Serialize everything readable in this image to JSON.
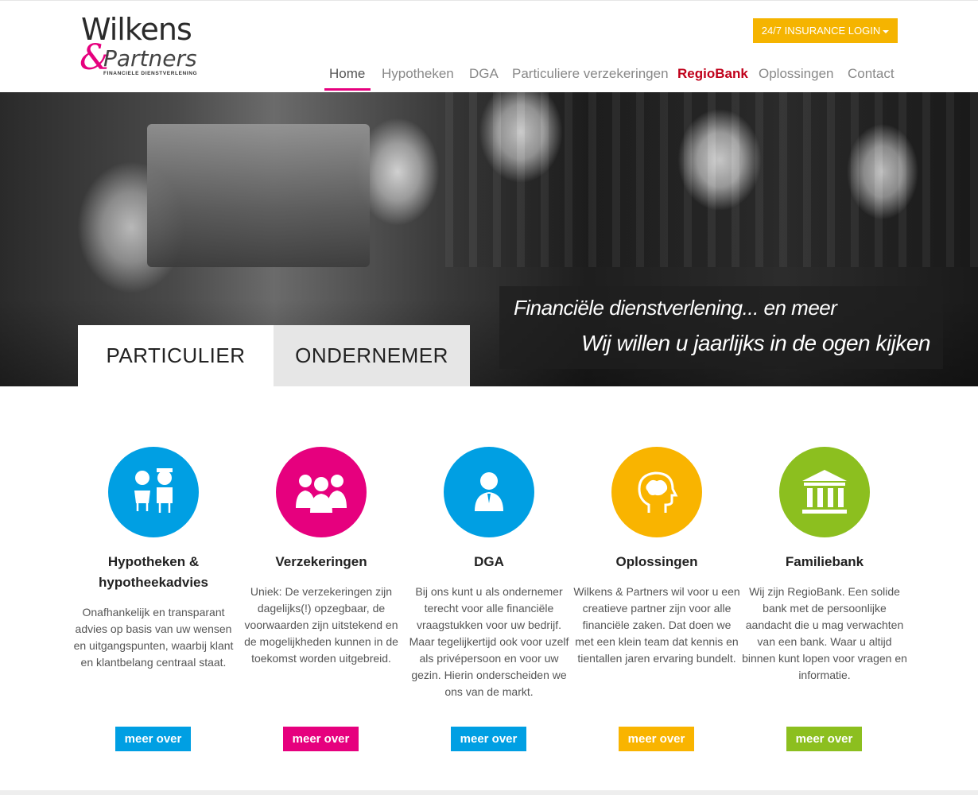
{
  "brand": {
    "name_top": "Wilkens",
    "name_bottom": "Partners",
    "ampersand": "&",
    "tagline": "FINANCIELE DIENSTVERLENING"
  },
  "header": {
    "login_label": "24/7 INSURANCE LOGIN",
    "nav": [
      {
        "label": "Home"
      },
      {
        "label": "Hypotheken"
      },
      {
        "label": "DGA"
      },
      {
        "label": "Particuliere verzekeringen"
      },
      {
        "label": "RegioBank"
      },
      {
        "label": "Oplossingen"
      },
      {
        "label": "Contact"
      }
    ]
  },
  "hero": {
    "line1": "Financiële dienstverlening... en meer",
    "line2": "Wij willen u jaarlijks in de ogen kijken",
    "tabs": [
      {
        "label": "PARTICULIER"
      },
      {
        "label": "ONDERNEMER"
      }
    ]
  },
  "features": [
    {
      "icon": "couple-icon",
      "color": "#009fe3",
      "title": "Hypotheken & hypotheekadvies",
      "text": "Onafhankelijk en transparant advies op basis van uw wensen en uitgangspunten, waarbij klant en klantbelang centraal staat.",
      "button": "meer over"
    },
    {
      "icon": "group-icon",
      "color": "#e6007e",
      "title": "Verzekeringen",
      "text": "Uniek: De verzekeringen zijn dagelijks(!) opzegbaar, de voorwaarden zijn uitstekend en de mogelijkheden kunnen in de toekomst worden uitgebreid.",
      "button": "meer over"
    },
    {
      "icon": "businessman-icon",
      "color": "#009fe3",
      "title": "DGA",
      "text": "Bij ons kunt u als ondernemer terecht voor alle financiële vraagstukken voor uw bedrijf. Maar tegelijkertijd ook voor uzelf als privépersoon en voor uw gezin. Hierin onderscheiden we ons van de markt.",
      "button": "meer over"
    },
    {
      "icon": "brain-icon",
      "color": "#f9b400",
      "title": "Oplossingen",
      "text": "Wilkens & Partners wil voor u een creatieve partner zijn voor alle financiële zaken. Dat doen we met een klein team dat kennis en tientallen jaren ervaring bundelt.",
      "button": "meer over"
    },
    {
      "icon": "bank-icon",
      "color": "#8cbf1f",
      "title": "Familiebank",
      "text": "Wij zijn RegioBank. Een solide bank met de persoonlijke aandacht die u mag verwachten van een bank. Waar u altijd binnen kunt lopen voor vragen en informatie.",
      "button": "meer over"
    }
  ]
}
